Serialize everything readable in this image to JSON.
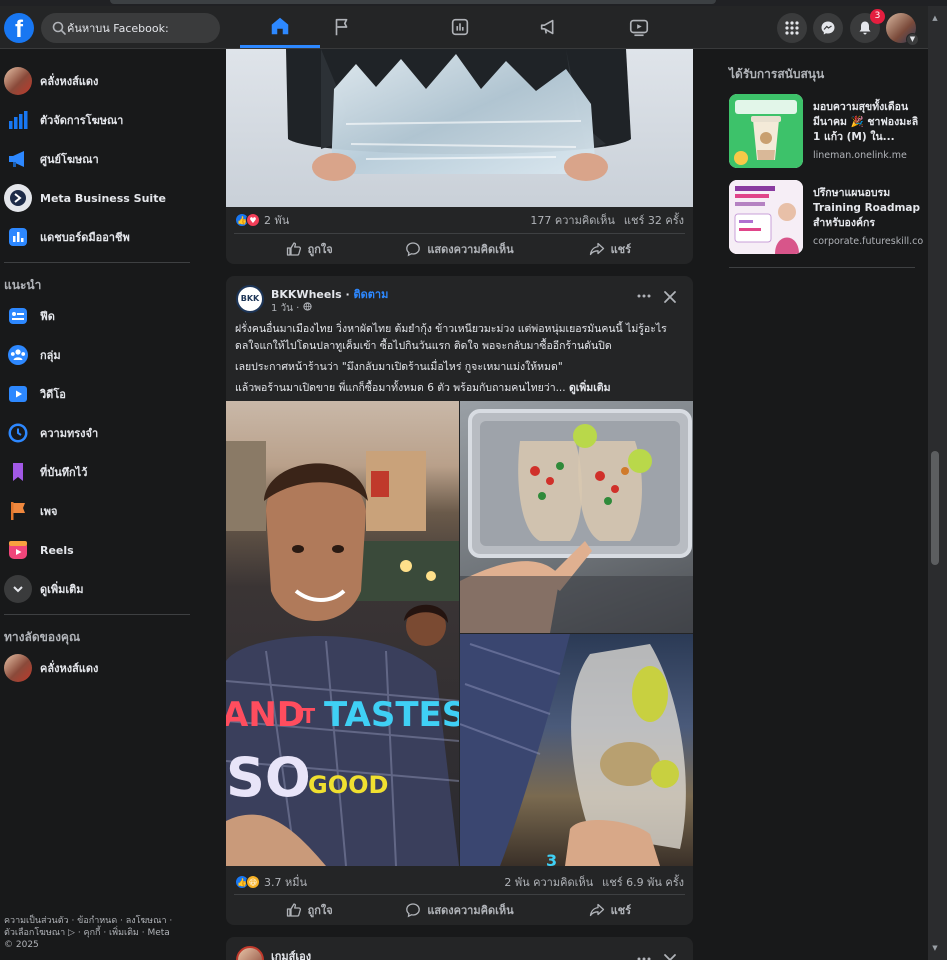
{
  "header": {
    "logo": "f",
    "search_placeholder": "ค้นหาบน Facebook:",
    "notification_count": "3",
    "nav_icons": [
      "home-icon",
      "flag-icon",
      "dashboard-icon",
      "megaphone-icon",
      "video-icon"
    ]
  },
  "sidebar": {
    "top_items": [
      {
        "label": "คลั่งหงส์แดง",
        "icon": "profile-avatar"
      },
      {
        "label": "ตัวจัดการโฆษณา",
        "icon": "ads-manager-icon"
      },
      {
        "label": "ศูนย์โฆษณา",
        "icon": "megaphone-icon"
      },
      {
        "label": "Meta Business Suite",
        "icon": "business-suite-icon"
      },
      {
        "label": "แดชบอร์ดมืออาชีพ",
        "icon": "dashboard-icon"
      }
    ],
    "recommended_title": "แนะนำ",
    "recommended_items": [
      {
        "label": "ฟีด",
        "icon": "feed-icon"
      },
      {
        "label": "กลุ่ม",
        "icon": "groups-icon"
      },
      {
        "label": "วิดีโอ",
        "icon": "video-icon"
      },
      {
        "label": "ความทรงจำ",
        "icon": "memories-icon"
      },
      {
        "label": "ที่บันทึกไว้",
        "icon": "saved-icon"
      },
      {
        "label": "เพจ",
        "icon": "pages-icon"
      },
      {
        "label": "Reels",
        "icon": "reels-icon"
      },
      {
        "label": "ดูเพิ่มเติม",
        "icon": "chevron-down-icon"
      }
    ],
    "shortcuts_title": "ทางลัดของคุณ",
    "shortcut_items": [
      {
        "label": "คลั่งหงส์แดง",
        "icon": "profile-avatar"
      }
    ],
    "footer_line1": "ความเป็นส่วนตัว · ข้อกำหนด · ลงโฆษณา ·",
    "footer_line2": "ตัวเลือกโฆษณา ▷ · คุกกี้ · เพิ่มเติม · Meta",
    "footer_line3": "© 2025"
  },
  "post1": {
    "reactions_count": "2 พัน",
    "comments": "177 ความคิดเห็น",
    "shares": "แชร์ 32 ครั้ง",
    "like_label": "ถูกใจ",
    "comment_label": "แสดงความคิดเห็น",
    "share_label": "แชร์"
  },
  "post2": {
    "page_name": "BKKWheels",
    "follow": "ติดตาม",
    "time": "1 วัน ·",
    "avatar_text": "BKK",
    "paragraph1": "ฝรั่งคนอื่นมาเมืองไทย วิ่งหาผัดไทย ต้มยำกุ้ง ข้าวเหนียวมะม่วง แต่พ่อหนุ่มเยอรมันคนนี้ ไม่รู้อะไรดลใจแกให้ไปโดนปลาทูเค็มเข้า ซื้อไปกินวันแรก ติดใจ พอจะกลับมาซื้ออีกร้านดันปิด",
    "paragraph2": "เลยประกาศหน้าร้านว่า \"มึงกลับมาเปิดร้านเมื่อไหร่ กูจะเหมาแม่งให้หมด\"",
    "paragraph3": "แล้วพอร้านมาเปิดขาย พี่แกก็ซื้อมาทั้งหมด 6 ตัว พร้อมกับถามคนไทยว่า...",
    "see_more": "ดูเพิ่มเติม",
    "caption_words": [
      "AND",
      "IT",
      "TASTES",
      "SO",
      "GOOD"
    ],
    "reactions_count": "3.7 หมื่น",
    "comments": "2 พัน ความคิดเห็น",
    "shares": "แชร์ 6.9 พัน ครั้ง",
    "like_label": "ถูกใจ",
    "comment_label": "แสดงความคิดเห็น",
    "share_label": "แชร์"
  },
  "post3": {
    "page_name": "เกมส์เอง"
  },
  "sponsored": {
    "title": "ได้รับการสนับสนุน",
    "ads": [
      {
        "title": "มอบความสุขทั้งเดือนมีนาคม 🎉 ชาฟองมะลิ 1 แก้ว (M) ใน...",
        "source": "lineman.onelink.me"
      },
      {
        "title": "ปรึกษาแผนอบรม Training Roadmap สำหรับองค์กร",
        "source": "corporate.futureskill.co"
      }
    ]
  }
}
